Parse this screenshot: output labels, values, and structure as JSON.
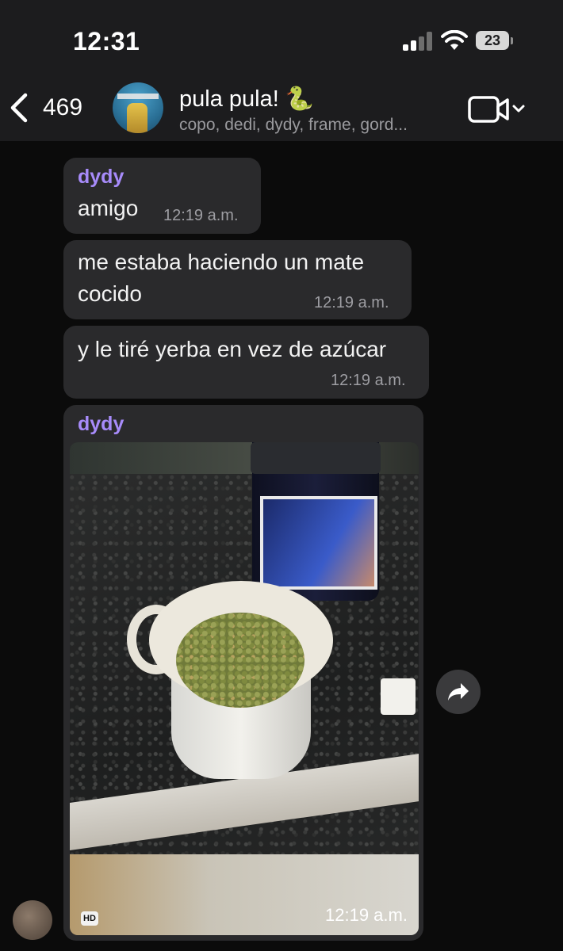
{
  "status_bar": {
    "time": "12:31",
    "battery": "23"
  },
  "header": {
    "back_count": "469",
    "title": "pula pula! 🐍",
    "members": "copo, dedi, dydy, frame, gord...",
    "icons": [
      "chevron-left-icon",
      "video-camera-icon",
      "chevron-down-icon"
    ]
  },
  "messages": [
    {
      "sender": "dydy",
      "text": "amigo",
      "time": "12:19 a.m."
    },
    {
      "text_line1": "me estaba haciendo un mate",
      "text_line2": "cocido",
      "time": "12:19 a.m."
    },
    {
      "text": "y le tiré yerba en vez de azúcar",
      "time": "12:19 a.m."
    },
    {
      "sender": "dydy",
      "badge": "HD",
      "time": "12:19 a.m.",
      "kind": "photo"
    }
  ],
  "colors": {
    "background": "#0b0b0b",
    "bubble": "#2a2a2c",
    "sender_name": "#a78bfa",
    "header": "#1c1c1e"
  }
}
